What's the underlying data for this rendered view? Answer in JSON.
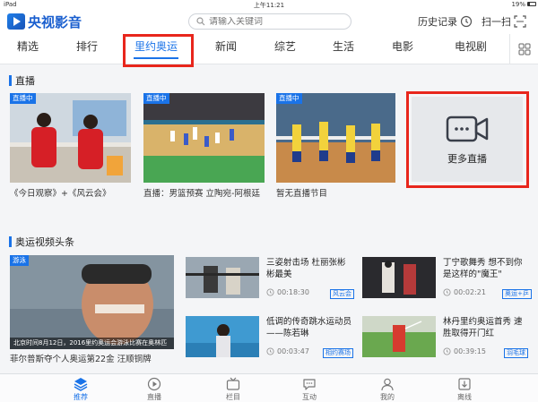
{
  "status_bar": {
    "device": "iPad",
    "time": "上午11:21",
    "battery": "19%"
  },
  "header": {
    "app_name": "央视影音",
    "search_placeholder": "请输入关键词",
    "history_label": "历史记录",
    "scan_label": "扫一扫"
  },
  "tabs": [
    {
      "label": "精选"
    },
    {
      "label": "排行"
    },
    {
      "label": "里约奥运",
      "active": true
    },
    {
      "label": "新闻"
    },
    {
      "label": "综艺"
    },
    {
      "label": "生活"
    },
    {
      "label": "电影"
    },
    {
      "label": "电视剧"
    }
  ],
  "live": {
    "section_title": "直播",
    "badge": "直播中",
    "items": [
      {
        "caption": "《今日观察》+《风云会》"
      },
      {
        "caption": "直播：男篮预赛 立陶宛-阿根廷"
      },
      {
        "caption": "暂无直播节目"
      }
    ],
    "more_label": "更多直播"
  },
  "news": {
    "section_title": "奥运视频头条",
    "featured": {
      "tag": "游泳",
      "overlay": "北京时间8月12日，2016里约奥运会游泳比赛在奥林匹",
      "title": "菲尔普斯夺个人奥运第22金 汪顺铜牌"
    },
    "items": [
      {
        "title": "三姿射击场 杜丽张彬彬最美",
        "duration": "00:18:30",
        "tag": "风云会"
      },
      {
        "title": "丁宁歌舞秀 想不到你是这样的\"魔王\"",
        "duration": "00:02:21",
        "tag": "奥运+乒"
      },
      {
        "title": "低调的传奇跳水运动员——陈若琳",
        "duration": "00:03:47",
        "tag": "相约赛场"
      },
      {
        "title": "林丹里约奥运首秀 速胜取得开门红",
        "duration": "00:39:15",
        "tag": "羽毛球"
      }
    ]
  },
  "bottom_nav": [
    {
      "label": "推荐",
      "icon": "layers-icon",
      "active": true
    },
    {
      "label": "直播",
      "icon": "play-circle-icon"
    },
    {
      "label": "栏目",
      "icon": "tv-icon"
    },
    {
      "label": "互动",
      "icon": "chat-icon"
    },
    {
      "label": "我的",
      "icon": "user-icon"
    },
    {
      "label": "离线",
      "icon": "download-icon"
    }
  ],
  "colors": {
    "accent": "#1a73e8",
    "highlight": "#e8261c",
    "brand": "#1a5fcf"
  }
}
